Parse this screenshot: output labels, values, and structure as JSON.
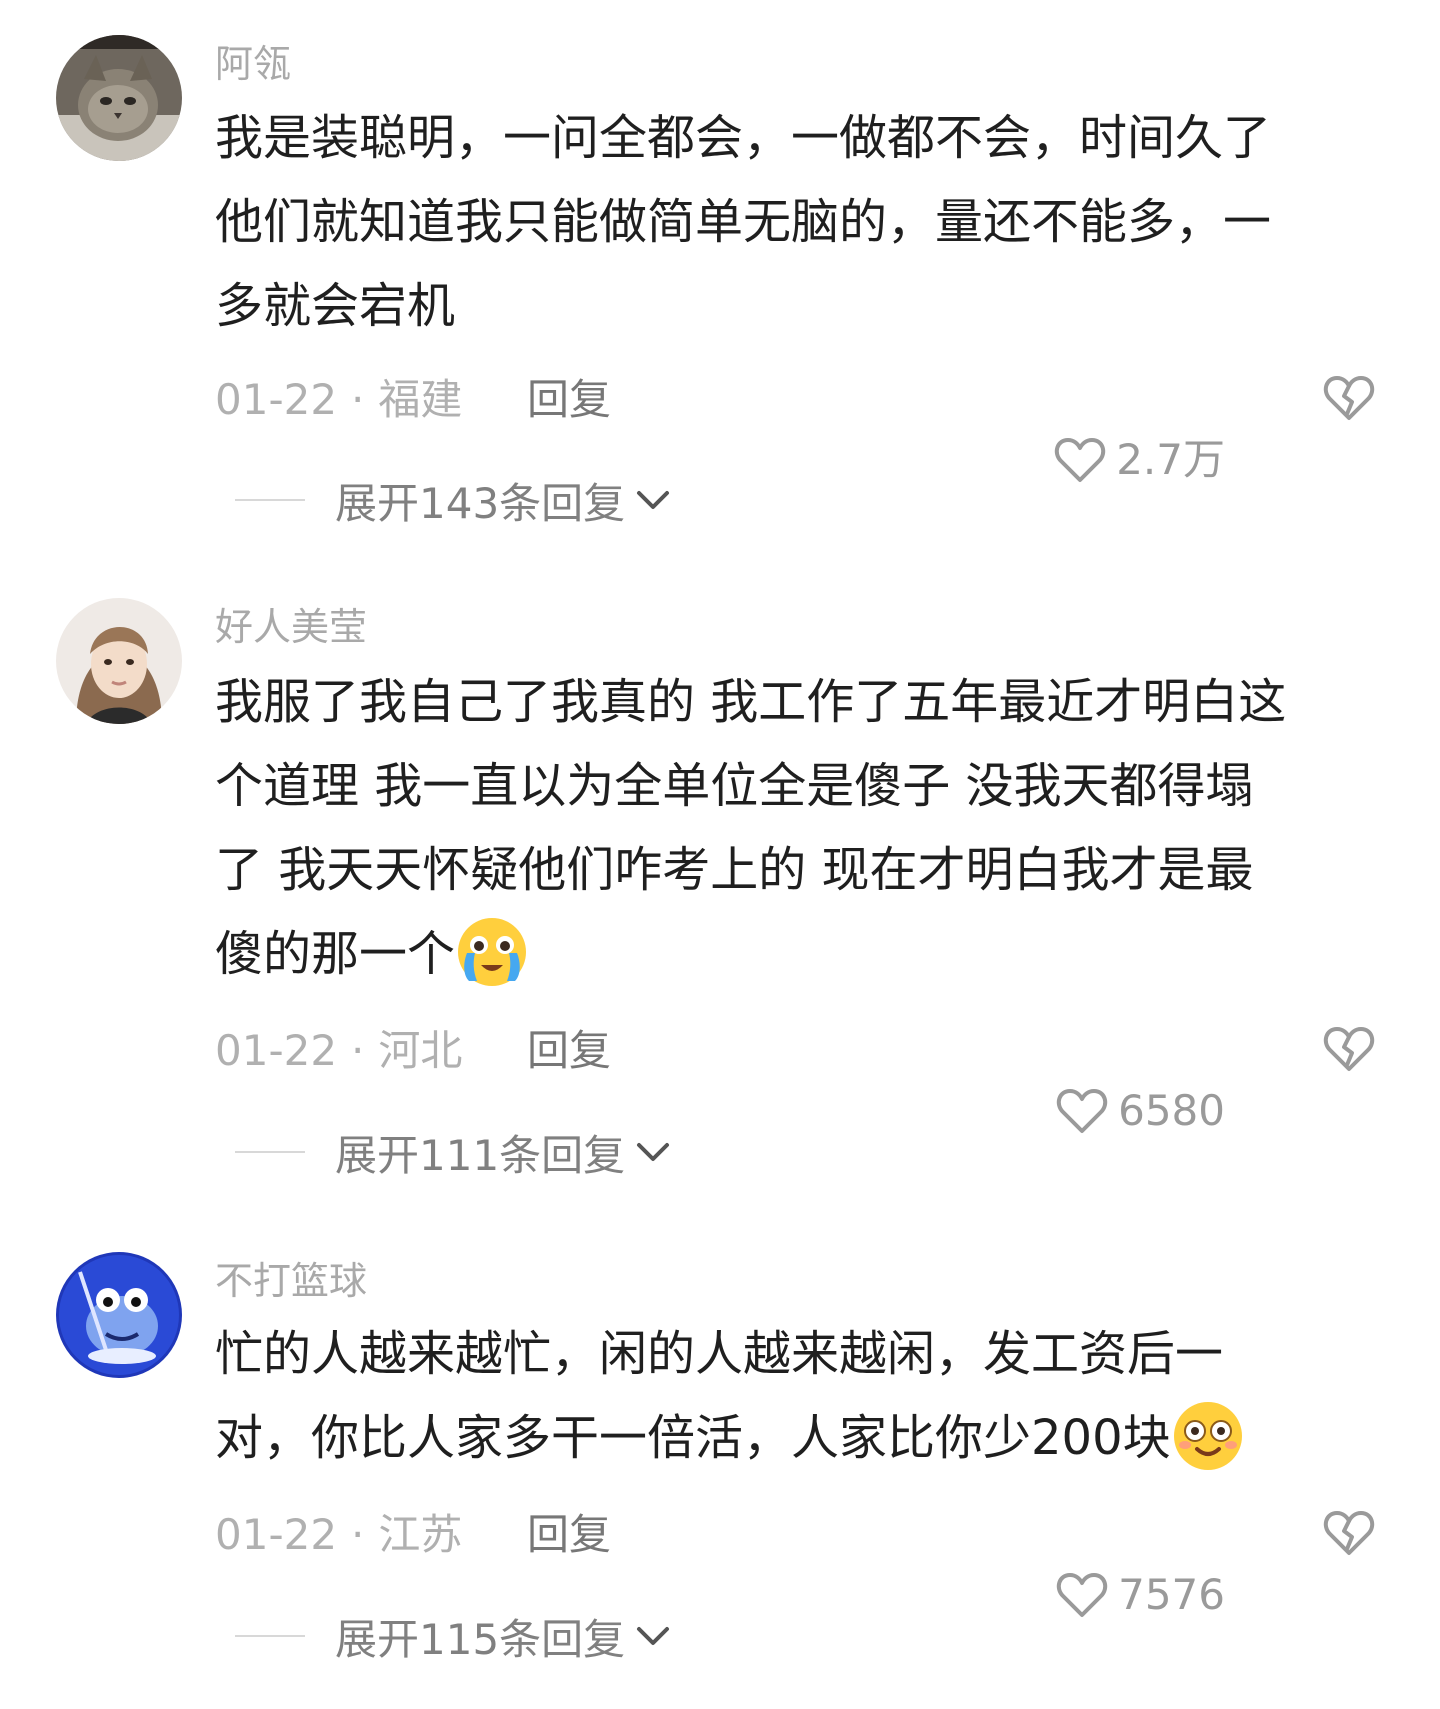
{
  "comments": [
    {
      "username": "阿瓴",
      "lines": [
        "我是装聪明，一问全都会，一做都不会，时间久了",
        "他们就知道我只能做简单无脑的，量还不能多，一",
        "多就会宕机"
      ],
      "date": "01-22",
      "region": "福建",
      "reply_label": "回复",
      "likes": "2.7万",
      "expand_label": "展开143条回复"
    },
    {
      "username": "好人美莹",
      "lines": [
        "我服了我自己了我真的 我工作了五年最近才明白这",
        "个道理 我一直以为全单位全是傻子 没我天都得塌",
        "了 我天天怀疑他们咋考上的 现在才明白我才是最",
        "傻的那一个"
      ],
      "emoji": "crying-emoji",
      "date": "01-22",
      "region": "河北",
      "reply_label": "回复",
      "likes": "6580",
      "expand_label": "展开111条回复"
    },
    {
      "username": "不打篮球",
      "lines": [
        "忙的人越来越忙，闲的人越来越闲，发工资后一",
        "对，你比人家多干一倍活，人家比你少200块"
      ],
      "emoji": "smile-emoji",
      "date": "01-22",
      "region": "江苏",
      "reply_label": "回复",
      "likes": "7576",
      "expand_label": "展开115条回复"
    }
  ],
  "separator": "·",
  "icons": {
    "like": "heart-outline-icon",
    "dislike": "broken-heart-icon",
    "expand": "chevron-down-icon"
  },
  "colors": {
    "text": "#1f1f1f",
    "username": "#a9a9a9",
    "meta": "#b0b0b0",
    "reply": "#777777",
    "expand": "#808080"
  }
}
